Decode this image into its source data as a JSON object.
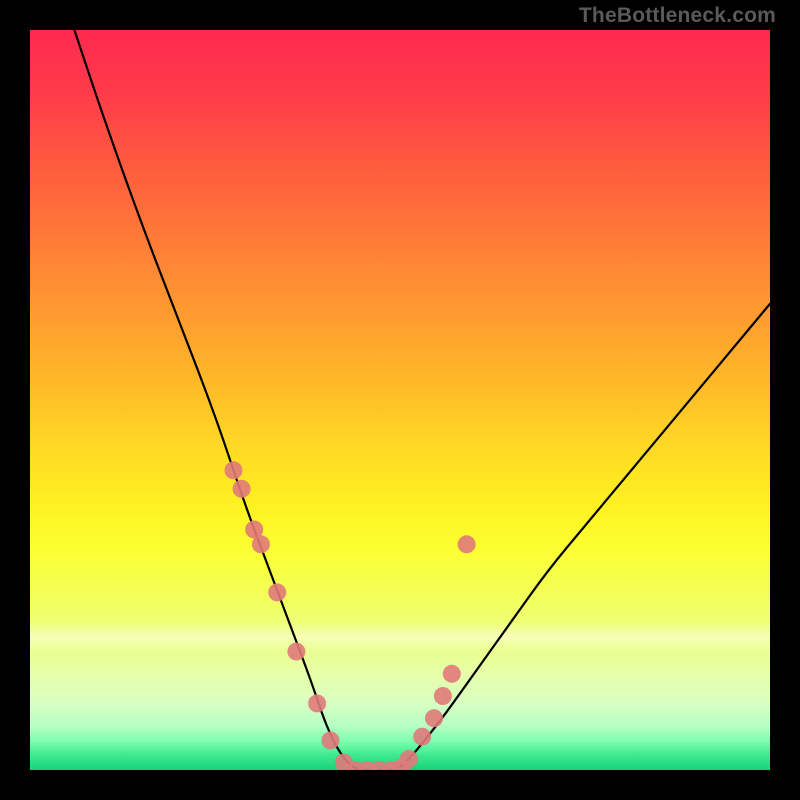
{
  "watermark": "TheBottleneck.com",
  "chart_data": {
    "type": "line",
    "title": "",
    "xlabel": "",
    "ylabel": "",
    "xlim": [
      0,
      100
    ],
    "ylim": [
      0,
      100
    ],
    "series": [
      {
        "name": "bottleneck-curve",
        "x": [
          6,
          10,
          15,
          20,
          25,
          29,
          32,
          35,
          38,
          40,
          42,
          44,
          46,
          48,
          50,
          55,
          60,
          65,
          70,
          75,
          80,
          85,
          90,
          95,
          100
        ],
        "y": [
          100,
          88,
          74,
          61,
          48,
          36,
          28,
          20,
          12,
          6,
          2,
          0,
          0,
          0,
          0,
          6,
          13,
          20,
          27,
          33,
          39,
          45,
          51,
          57,
          63
        ]
      }
    ],
    "markers": {
      "name": "highlighted-points",
      "color": "#e07a7a",
      "x": [
        27.5,
        28.6,
        30.3,
        31.2,
        33.4,
        36.0,
        38.8,
        40.6,
        42.4,
        44.0,
        45.6,
        47.2,
        48.8,
        50.2,
        51.2,
        53.0,
        54.6,
        55.8,
        57.0,
        59.0
      ],
      "y": [
        40.5,
        38.0,
        32.5,
        30.5,
        24.0,
        16.0,
        9.0,
        4.0,
        1.0,
        0.0,
        0.0,
        0.0,
        0.0,
        0.3,
        1.5,
        4.5,
        7.0,
        10.0,
        13.0,
        30.5
      ]
    },
    "background_gradient": {
      "stops": [
        {
          "pct": 0,
          "color": "#ff2a4f"
        },
        {
          "pct": 50,
          "color": "#ffd824"
        },
        {
          "pct": 80,
          "color": "#f4ff50"
        },
        {
          "pct": 100,
          "color": "#14d37a"
        }
      ]
    }
  }
}
